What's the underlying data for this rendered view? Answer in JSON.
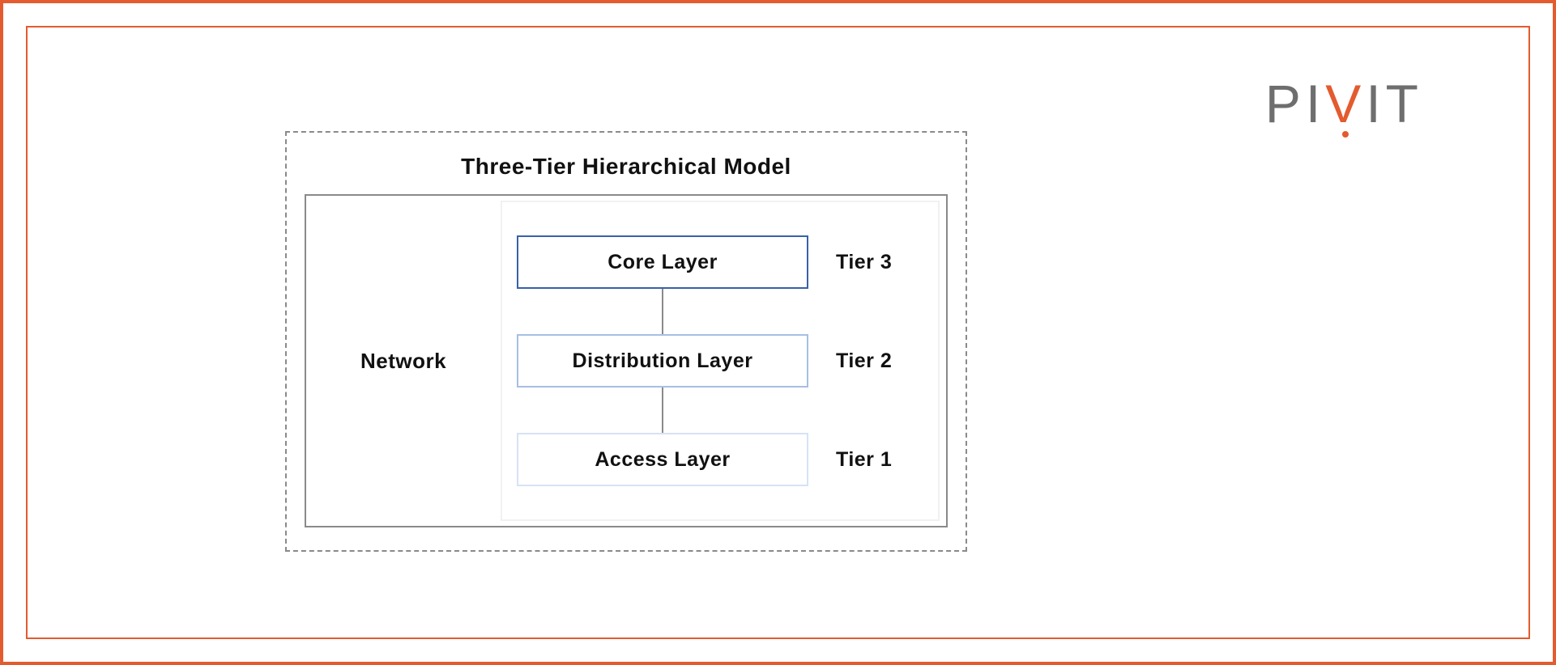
{
  "logo": {
    "p1": "P",
    "i1": "I",
    "v": "V",
    "i2": "I",
    "t": "T"
  },
  "diagram": {
    "title": "Three-Tier Hierarchical Model",
    "network_label": "Network",
    "layers": {
      "core": "Core Layer",
      "distribution": "Distribution Layer",
      "access": "Access Layer"
    },
    "tiers": {
      "tier3": "Tier 3",
      "tier2": "Tier 2",
      "tier1": "Tier 1"
    }
  }
}
